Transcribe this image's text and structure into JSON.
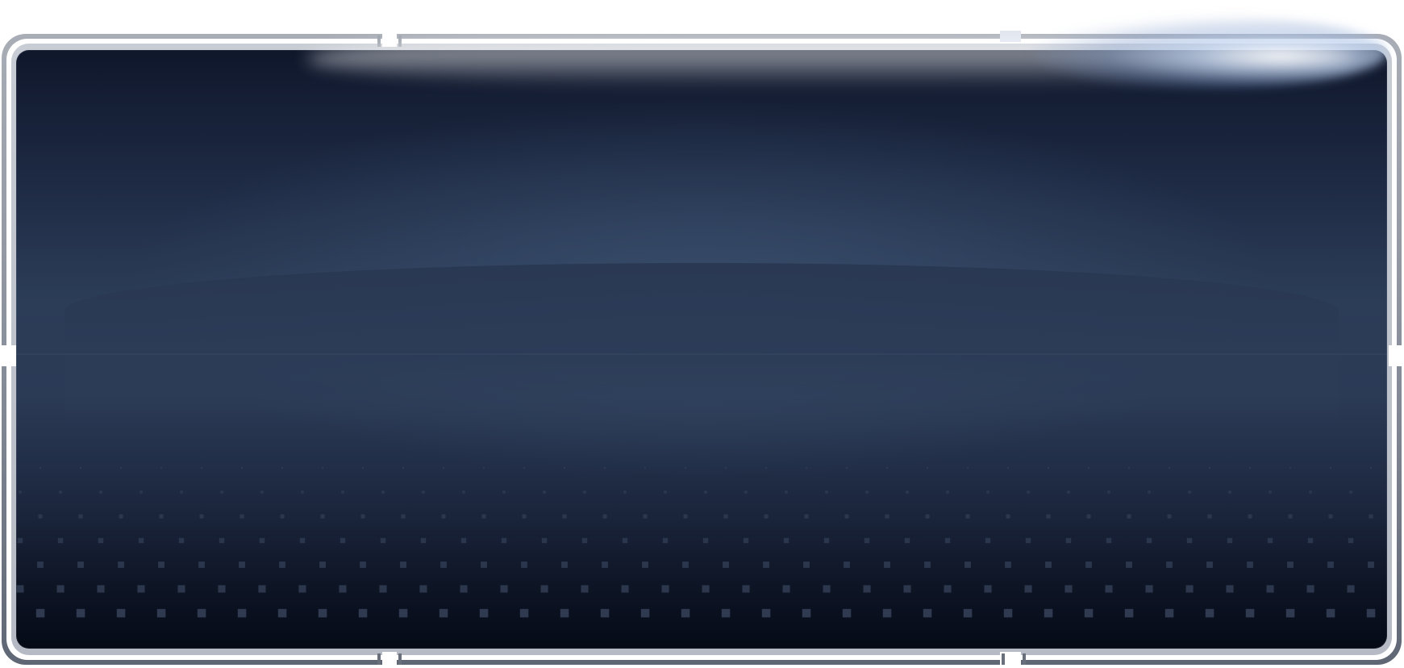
{
  "screen": {
    "state": "blank",
    "background_colors": {
      "top": "#0f172b",
      "middle": "#2c3d58",
      "bottom": "#050a16"
    },
    "dot_color": "#3a4760"
  },
  "frame": {
    "color": "#8a909b",
    "highlight": "#ffffff"
  }
}
